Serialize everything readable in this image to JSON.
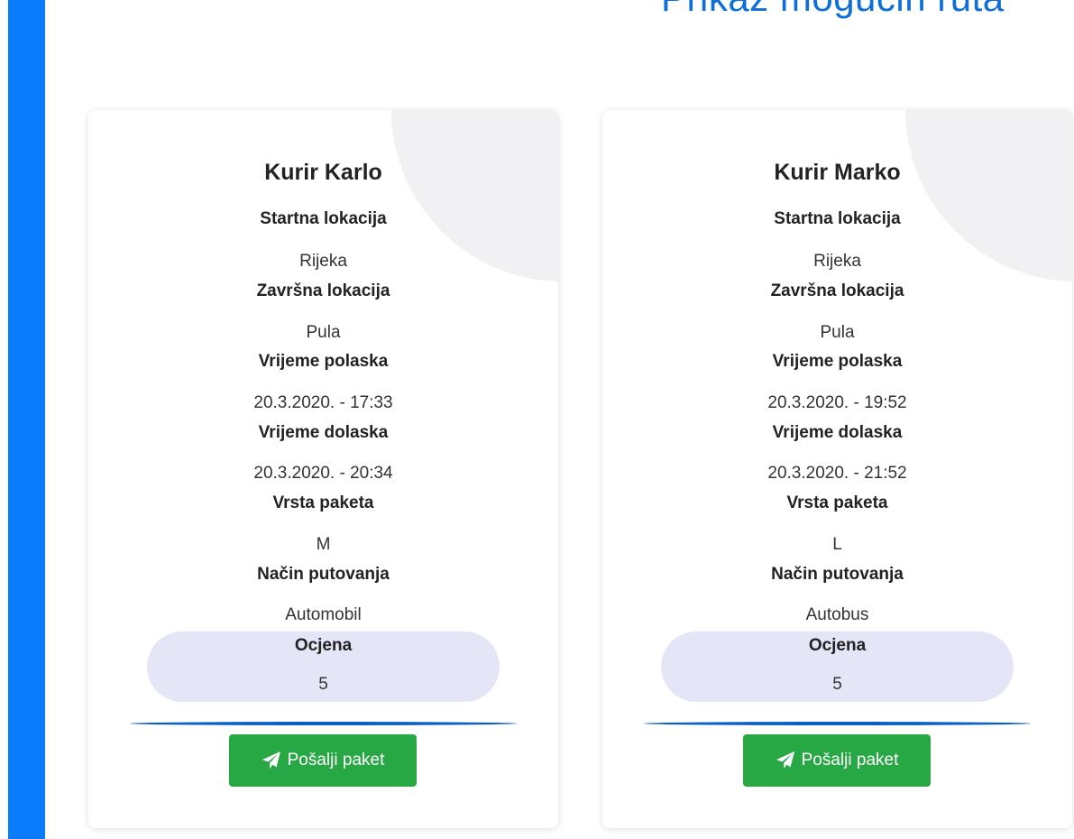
{
  "page": {
    "title": "Prikaz mogućih ruta"
  },
  "colors": {
    "accent_bar": "#0a7cfb",
    "title": "#0f6fd8",
    "button": "#28a745",
    "rating_bg": "#e5e5f8"
  },
  "labels": {
    "start": "Startna lokacija",
    "end": "Završna lokacija",
    "departure": "Vrijeme polaska",
    "arrival": "Vrijeme dolaska",
    "package": "Vrsta paketa",
    "travel": "Način putovanja",
    "rating": "Ocjena"
  },
  "routes": [
    {
      "courier": "Kurir Karlo",
      "start": "Rijeka",
      "end": "Pula",
      "departure": "20.3.2020. - 17:33",
      "arrival": "20.3.2020. - 20:34",
      "package": "M",
      "travel": "Automobil",
      "rating": "5",
      "button_label": "Pošalji paket",
      "button_icon": "paper-plane-icon"
    },
    {
      "courier": "Kurir Marko",
      "start": "Rijeka",
      "end": "Pula",
      "departure": "20.3.2020. - 19:52",
      "arrival": "20.3.2020. - 21:52",
      "package": "L",
      "travel": "Autobus",
      "rating": "5",
      "button_label": "Pošalji paket",
      "button_icon": "paper-plane-icon"
    }
  ]
}
